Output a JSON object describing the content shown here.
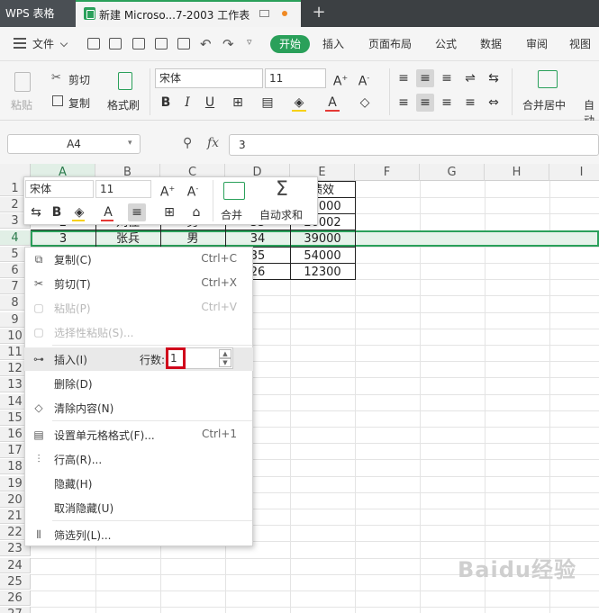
{
  "titlebar": {
    "app_tab": "WPS 表格",
    "doc_tab": "新建 Microso...7-2003 工作表"
  },
  "menubar": {
    "file": "文件",
    "tabs": [
      "开始",
      "插入",
      "页面布局",
      "公式",
      "数据",
      "审阅",
      "视图"
    ]
  },
  "ribbon": {
    "paste": "粘贴",
    "cut": "剪切",
    "copy": "复制",
    "format_painter": "格式刷",
    "font_name": "宋体",
    "font_size": "11",
    "merge_center": "合并居中",
    "auto_wrap": "自动"
  },
  "formula_bar": {
    "name_box": "A4",
    "fx": "fx",
    "value": "3"
  },
  "columns": [
    "A",
    "B",
    "C",
    "D",
    "E",
    "F",
    "G",
    "H",
    "I"
  ],
  "selected_column": "A",
  "rows": [
    "1",
    "2",
    "3",
    "4",
    "5",
    "6",
    "7",
    "8",
    "9",
    "10",
    "11",
    "12",
    "13",
    "14",
    "15",
    "16",
    "17",
    "18",
    "19",
    "20",
    "21",
    "22",
    "23",
    "24",
    "25",
    "26",
    "27"
  ],
  "selected_row": "4",
  "cells": {
    "e1": "绩效",
    "e2": "20000",
    "e3": "26002",
    "a3": "2",
    "b3": "刘佳",
    "c3": "男",
    "d3": "33",
    "a4": "3",
    "b4": "张兵",
    "c4": "男",
    "d4": "34",
    "e4": "39000",
    "d5": "35",
    "e5": "54000",
    "d6": "26",
    "e6": "12300"
  },
  "mini_toolbar": {
    "font_name": "宋体",
    "font_size": "11",
    "merge": "合并",
    "autosum": "自动求和"
  },
  "context_menu": {
    "copy": "复制(C)",
    "copy_shortcut": "Ctrl+C",
    "cut": "剪切(T)",
    "cut_shortcut": "Ctrl+X",
    "paste": "粘贴(P)",
    "paste_shortcut": "Ctrl+V",
    "paste_special": "选择性粘贴(S)...",
    "insert": "插入(I)",
    "rows_label": "行数:",
    "rows_value": "1",
    "delete": "删除(D)",
    "clear": "清除内容(N)",
    "format_cells": "设置单元格格式(F)...",
    "format_shortcut": "Ctrl+1",
    "row_height": "行高(R)...",
    "hide": "隐藏(H)",
    "unhide": "取消隐藏(U)",
    "filter_column": "筛选列(L)..."
  },
  "watermark": "Baidu经验",
  "colors": {
    "accent": "#2aa05a",
    "title_bar": "#3c4043",
    "highlight_box": "#d0021b"
  }
}
